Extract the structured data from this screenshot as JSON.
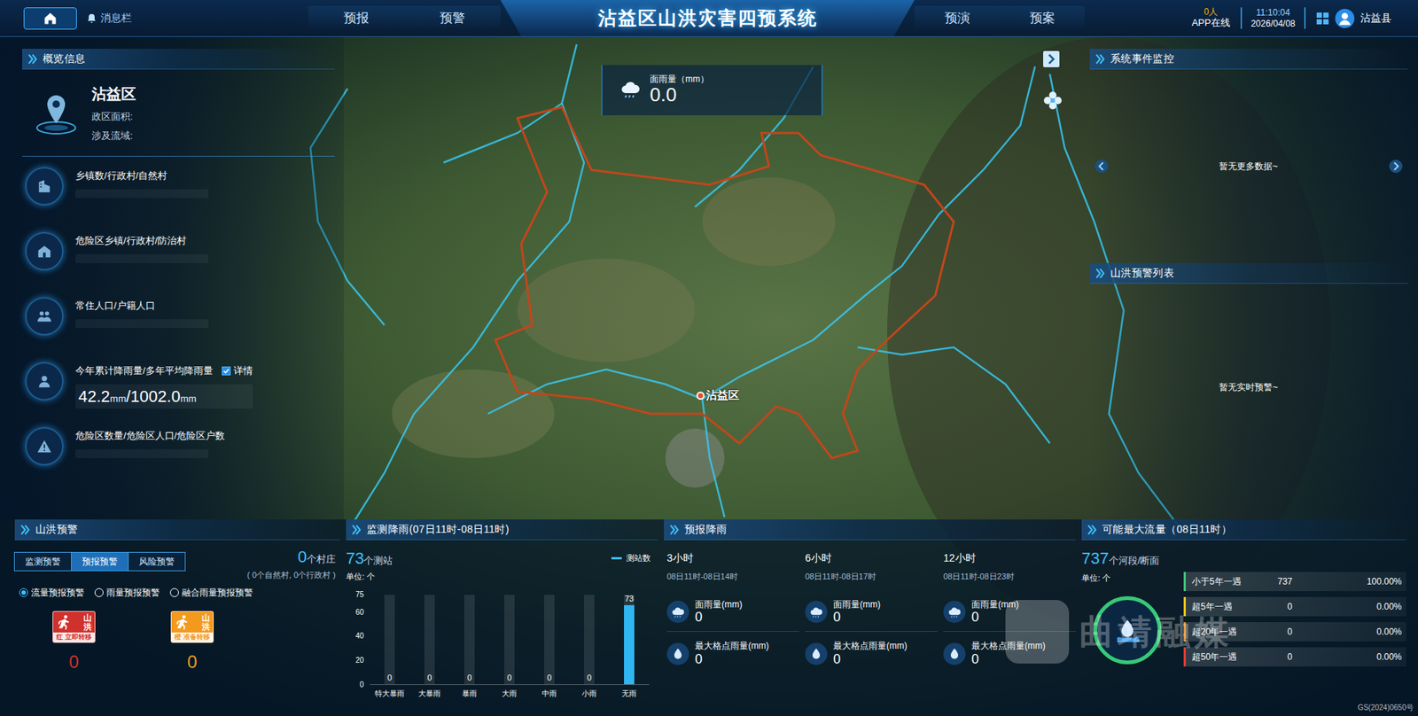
{
  "header": {
    "message": "消息栏",
    "nav_left": [
      {
        "label": "预报",
        "selected": false
      },
      {
        "label": "预警",
        "selected": false
      }
    ],
    "title": "沾益区山洪灾害四预系统",
    "nav_right": [
      {
        "label": "预演",
        "selected": false
      },
      {
        "label": "预案",
        "selected": false
      }
    ],
    "app_count": "0人",
    "app_label": "APP在线",
    "time": "11:10:04",
    "date": "2026/04/08",
    "user": "沾益县"
  },
  "map": {
    "rain_label": "面雨量（mm）",
    "rain_value": "0.0",
    "marker": "沾益区",
    "credit": "GS(2024)0650号",
    "watermark": "曲靖融媒"
  },
  "overview": {
    "title": "概览信息",
    "name": "沾益区",
    "fields": [
      "政区面积:",
      "涉及流域:"
    ],
    "items": [
      {
        "label": "乡镇数/行政村/自然村",
        "value_parts": []
      },
      {
        "label": "危险区乡镇/行政村/防治村",
        "value_parts": []
      },
      {
        "label": "常住人口/户籍人口",
        "value_parts": []
      },
      {
        "label": "今年累计降雨量/多年平均降雨量",
        "details": {
          "label": "详情",
          "checked": true
        },
        "value_parts": [
          {
            "text": "42.2",
            "kind": "number"
          },
          {
            "text": "mm",
            "kind": "unit"
          },
          {
            "text": "/1002.0",
            "kind": "number"
          },
          {
            "text": "mm",
            "kind": "unit"
          }
        ]
      },
      {
        "label": "危险区数量/危险区人口/危险区户数",
        "value_parts": []
      }
    ]
  },
  "event_monitor": {
    "title": "系统事件监控",
    "empty": "暂无更多数据~"
  },
  "warning_list": {
    "title": "山洪预警列表",
    "empty": "暂无实时预警~"
  },
  "flood_warning": {
    "title": "山洪预警",
    "tabs": [
      {
        "label": "监测预警",
        "selected": false
      },
      {
        "label": "预报预警",
        "selected": true
      },
      {
        "label": "风险预警",
        "selected": false
      }
    ],
    "count": "0",
    "count_unit": "个村庄",
    "sub": "( 0个自然村, 0个行政村 )",
    "radios": [
      {
        "label": "流量预报预警",
        "selected": true
      },
      {
        "label": "雨量预报预警",
        "selected": false
      },
      {
        "label": "融合雨量预报预警",
        "selected": false
      }
    ],
    "levels": [
      {
        "name": "山洪",
        "level": "红",
        "action": "立即转移",
        "value": "0",
        "color": "#d0312d"
      },
      {
        "name": "山洪",
        "level": "橙",
        "action": "准备转移",
        "value": "0",
        "color": "#f39a1e"
      }
    ]
  },
  "monitor_rain": {
    "title": "监测降雨(07日11时-08日11时)",
    "count": "73",
    "count_unit": "个测站",
    "legend": "测站数",
    "unit": "单位: 个",
    "y_ticks": [
      "75",
      "60",
      "40",
      "20",
      "0"
    ],
    "categories": [
      "特大暴雨",
      "大暴雨",
      "暴雨",
      "大雨",
      "中雨",
      "小雨",
      "无雨"
    ],
    "values": [
      0,
      0,
      0,
      0,
      0,
      0,
      73
    ],
    "value_labels": [
      "0",
      "0",
      "0",
      "0",
      "0",
      "0",
      "73"
    ]
  },
  "forecast_rain": {
    "title": "预报降雨",
    "columns": [
      {
        "title": "3小时",
        "range": "08日11时-08日14时",
        "area_label": "面雨量(mm)",
        "area_value": "0",
        "max_label": "最大格点雨量(mm)",
        "max_value": "0"
      },
      {
        "title": "6小时",
        "range": "08日11时-08日17时",
        "area_label": "面雨量(mm)",
        "area_value": "0",
        "max_label": "最大格点雨量(mm)",
        "max_value": "0"
      },
      {
        "title": "12小时",
        "range": "08日11时-08日23时",
        "area_label": "面雨量(mm)",
        "area_value": "0",
        "max_label": "最大格点雨量(mm)",
        "max_value": "0"
      }
    ]
  },
  "max_flow": {
    "title": "可能最大流量（08日11时）",
    "count": "737",
    "count_unit": "个河段/断面",
    "unit": "单位: 个",
    "rows": [
      {
        "label": "小于5年一遇",
        "count": "737",
        "pct": "100.00%",
        "color": "#3cc47a"
      },
      {
        "label": "超5年一遇",
        "count": "0",
        "pct": "0.00%",
        "color": "#f0c419"
      },
      {
        "label": "超20年一遇",
        "count": "0",
        "pct": "0.00%",
        "color": "#e08a1e"
      },
      {
        "label": "超50年一遇",
        "count": "0",
        "pct": "0.00%",
        "color": "#e53935"
      }
    ]
  }
}
